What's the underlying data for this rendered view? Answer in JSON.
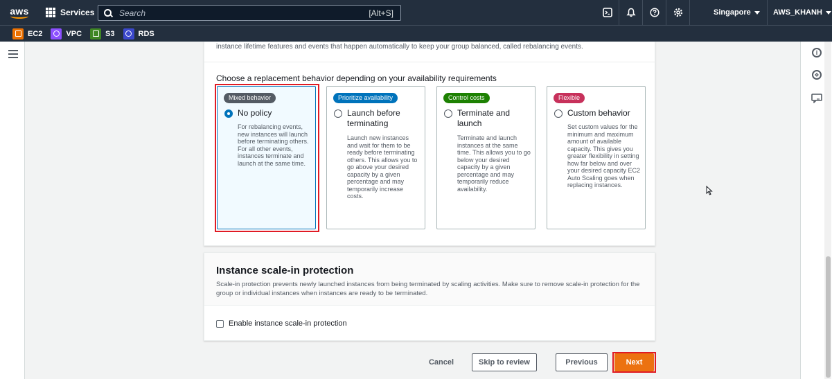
{
  "topnav": {
    "logo_text": "aws",
    "services_label": "Services",
    "search_placeholder": "Search",
    "search_shortcut": "[Alt+S]",
    "icons": [
      "cloudshell-icon",
      "bell-icon",
      "help-icon",
      "settings-icon"
    ],
    "region": "Singapore",
    "account": "AWS_KHANH"
  },
  "favorites": [
    {
      "label": "EC2",
      "color": "#ed7100"
    },
    {
      "label": "VPC",
      "color": "#8c4fff"
    },
    {
      "label": "S3",
      "color": "#3f8624"
    },
    {
      "label": "RDS",
      "color": "#3b48cc"
    }
  ],
  "rebalancing": {
    "intro": "instance lifetime features and events that happen automatically to keep your group balanced, called rebalancing events.",
    "choose_label": "Choose a replacement behavior depending on your availability requirements",
    "options": [
      {
        "badge": "Mixed behavior",
        "badge_color": "#545b64",
        "title": "No policy",
        "description": "For rebalancing events, new instances will launch before terminating others. For all other events, instances terminate and launch at the same time.",
        "selected": true
      },
      {
        "badge": "Prioritize availability",
        "badge_color": "#0073bb",
        "title": "Launch before terminating",
        "description": "Launch new instances and wait for them to be ready before terminating others. This allows you to go above your desired capacity by a given percentage and may temporarily increase costs.",
        "selected": false
      },
      {
        "badge": "Control costs",
        "badge_color": "#1d8102",
        "title": "Terminate and launch",
        "description": "Terminate and launch instances at the same time. This allows you to go below your desired capacity by a given percentage and may temporarily reduce availability.",
        "selected": false
      },
      {
        "badge": "Flexible",
        "badge_color": "#c7315b",
        "title": "Custom behavior",
        "description": "Set custom values for the minimum and maximum amount of available capacity. This gives you greater flexibility in setting how far below and over your desired capacity EC2 Auto Scaling goes when replacing instances.",
        "selected": false
      }
    ]
  },
  "scale_in": {
    "title": "Instance scale-in protection",
    "description": "Scale-in protection prevents newly launched instances from being terminated by scaling activities. Make sure to remove scale-in protection for the group or individual instances when instances are ready to be terminated.",
    "checkbox_label": "Enable instance scale-in protection",
    "checked": false
  },
  "footer": {
    "cancel": "Cancel",
    "skip": "Skip to review",
    "previous": "Previous",
    "next": "Next"
  }
}
